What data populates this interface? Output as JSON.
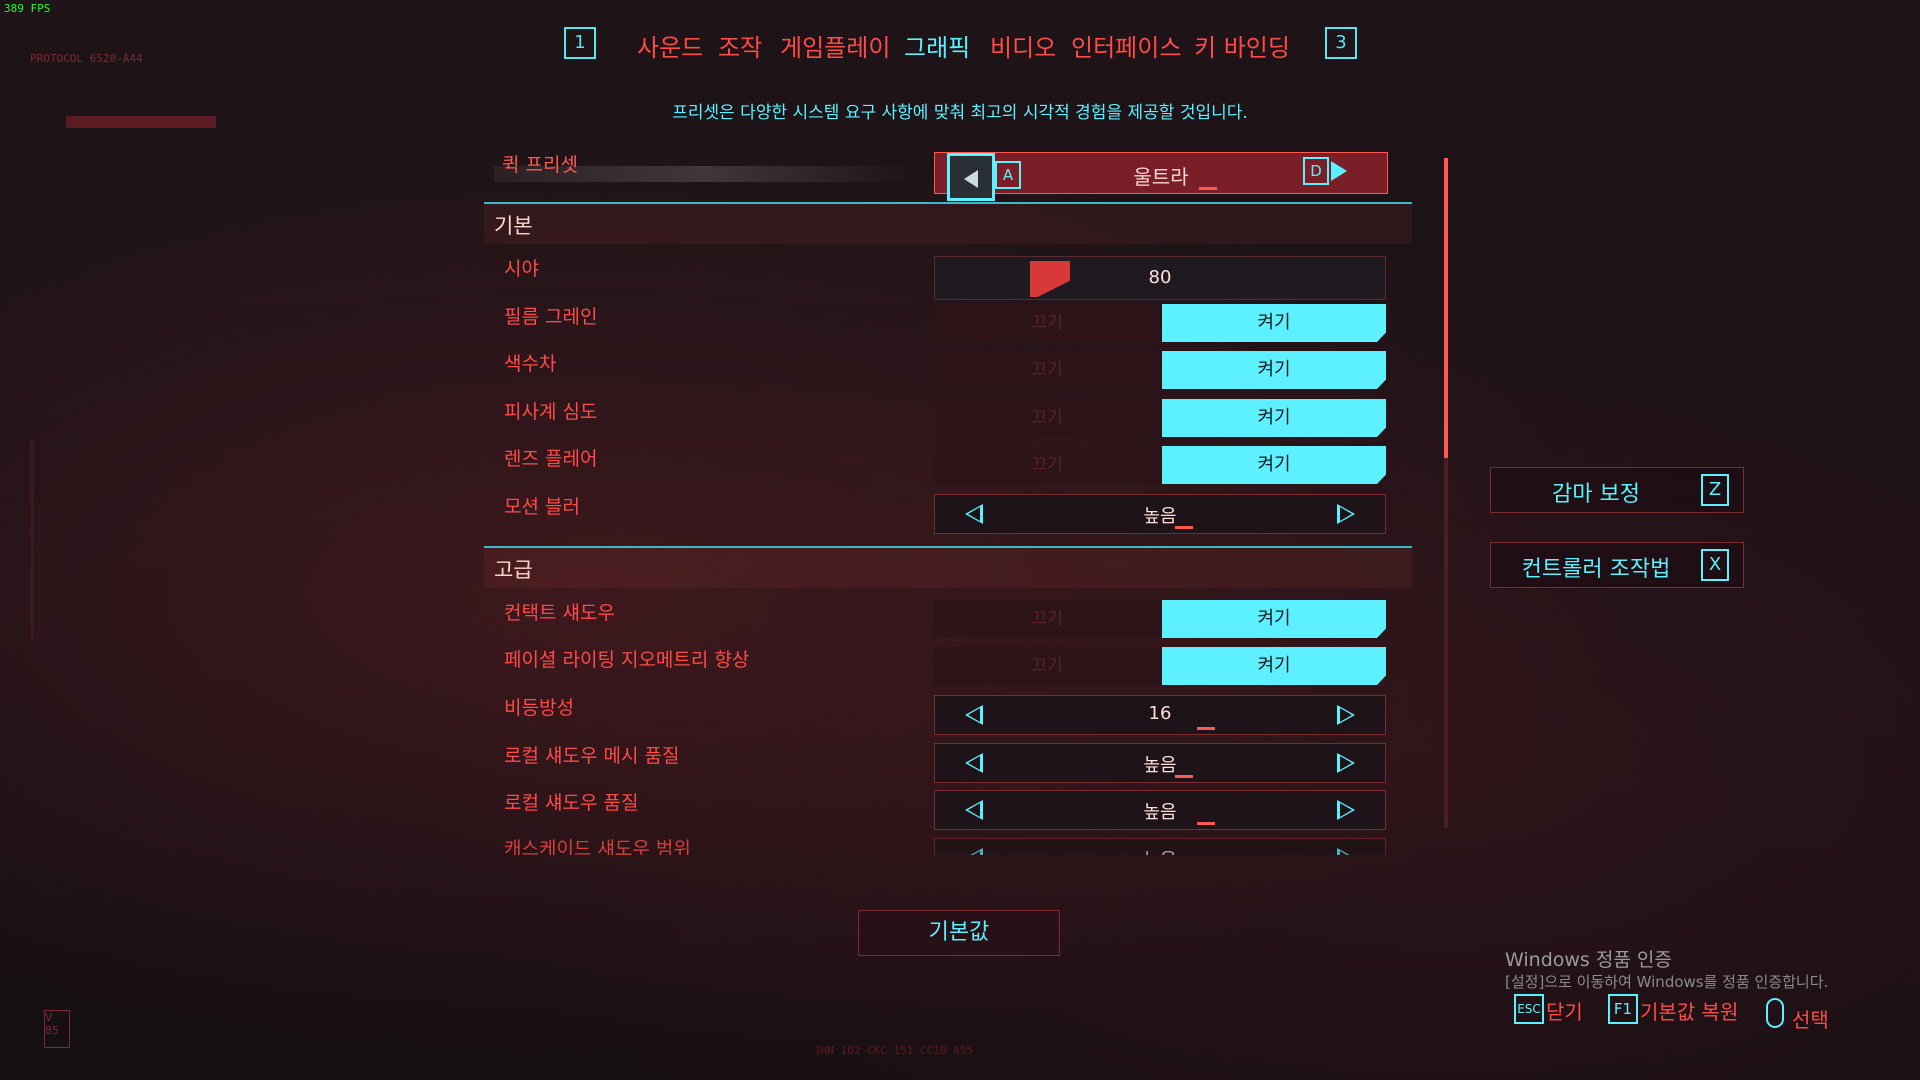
{
  "fps": "389 FPS",
  "tabs": {
    "left_key": "1",
    "right_key": "3",
    "items": [
      "사운드",
      "조작",
      "게임플레이",
      "그래픽",
      "비디오",
      "인터페이스",
      "키 바인딩"
    ],
    "active": "그래픽"
  },
  "subtitle": "프리셋은 다양한 시스템 요구 사항에 맞춰 최고의 시각적 경험을 제공할 것입니다.",
  "preset": {
    "label": "퀵 프리셋",
    "value": "울트라",
    "key_left": "A",
    "key_right": "D"
  },
  "sections": {
    "basic": "기본",
    "advanced": "고급"
  },
  "settings": {
    "fov": {
      "label": "시야",
      "value": "80",
      "fill_fraction": 0.3
    },
    "film_grain": {
      "label": "필름 그레인",
      "off": "끄기",
      "on": "켜기"
    },
    "chromatic": {
      "label": "색수차",
      "off": "끄기",
      "on": "켜기"
    },
    "dof": {
      "label": "피사계 심도",
      "off": "끄기",
      "on": "켜기"
    },
    "lens_flare": {
      "label": "렌즈 플레어",
      "off": "끄기",
      "on": "켜기"
    },
    "motion_blur": {
      "label": "모션 블러",
      "value": "높음"
    },
    "contact_shadow": {
      "label": "컨택트 섀도우",
      "off": "끄기",
      "on": "켜기"
    },
    "facial_lighting": {
      "label": "페이셜 라이팅 지오메트리 향상",
      "off": "끄기",
      "on": "켜기"
    },
    "anisotropy": {
      "label": "비등방성",
      "value": "16"
    },
    "local_shadow_mesh": {
      "label": "로컬 섀도우 메시 품질",
      "value": "높음"
    },
    "local_shadow": {
      "label": "로컬 섀도우 품질",
      "value": "높음"
    },
    "cascade_shadow": {
      "label": "캐스케이드 섀도우 범위",
      "value": "높음"
    }
  },
  "side_buttons": {
    "gamma": {
      "label": "감마 보정",
      "key": "Z"
    },
    "controller": {
      "label": "컨트롤러 조작법",
      "key": "X"
    }
  },
  "default_button": "기본값",
  "windows": {
    "title": "Windows 정품 인증",
    "subtitle": "[설정]으로 이동하여 Windows를 정품 인증합니다."
  },
  "hints": {
    "close_key": "ESC",
    "close": "닫기",
    "reset_key": "F1",
    "reset": "기본값 복원",
    "select": "선택"
  },
  "deco": {
    "logo": "PROTOCOL 6520-A44",
    "bottom": "JHN 102 CKC 151 CC10 A55",
    "badge": "V 85"
  },
  "colors": {
    "accent_cyan": "#5df0ff",
    "accent_red": "#ff4a48",
    "background": "#1a1216"
  }
}
